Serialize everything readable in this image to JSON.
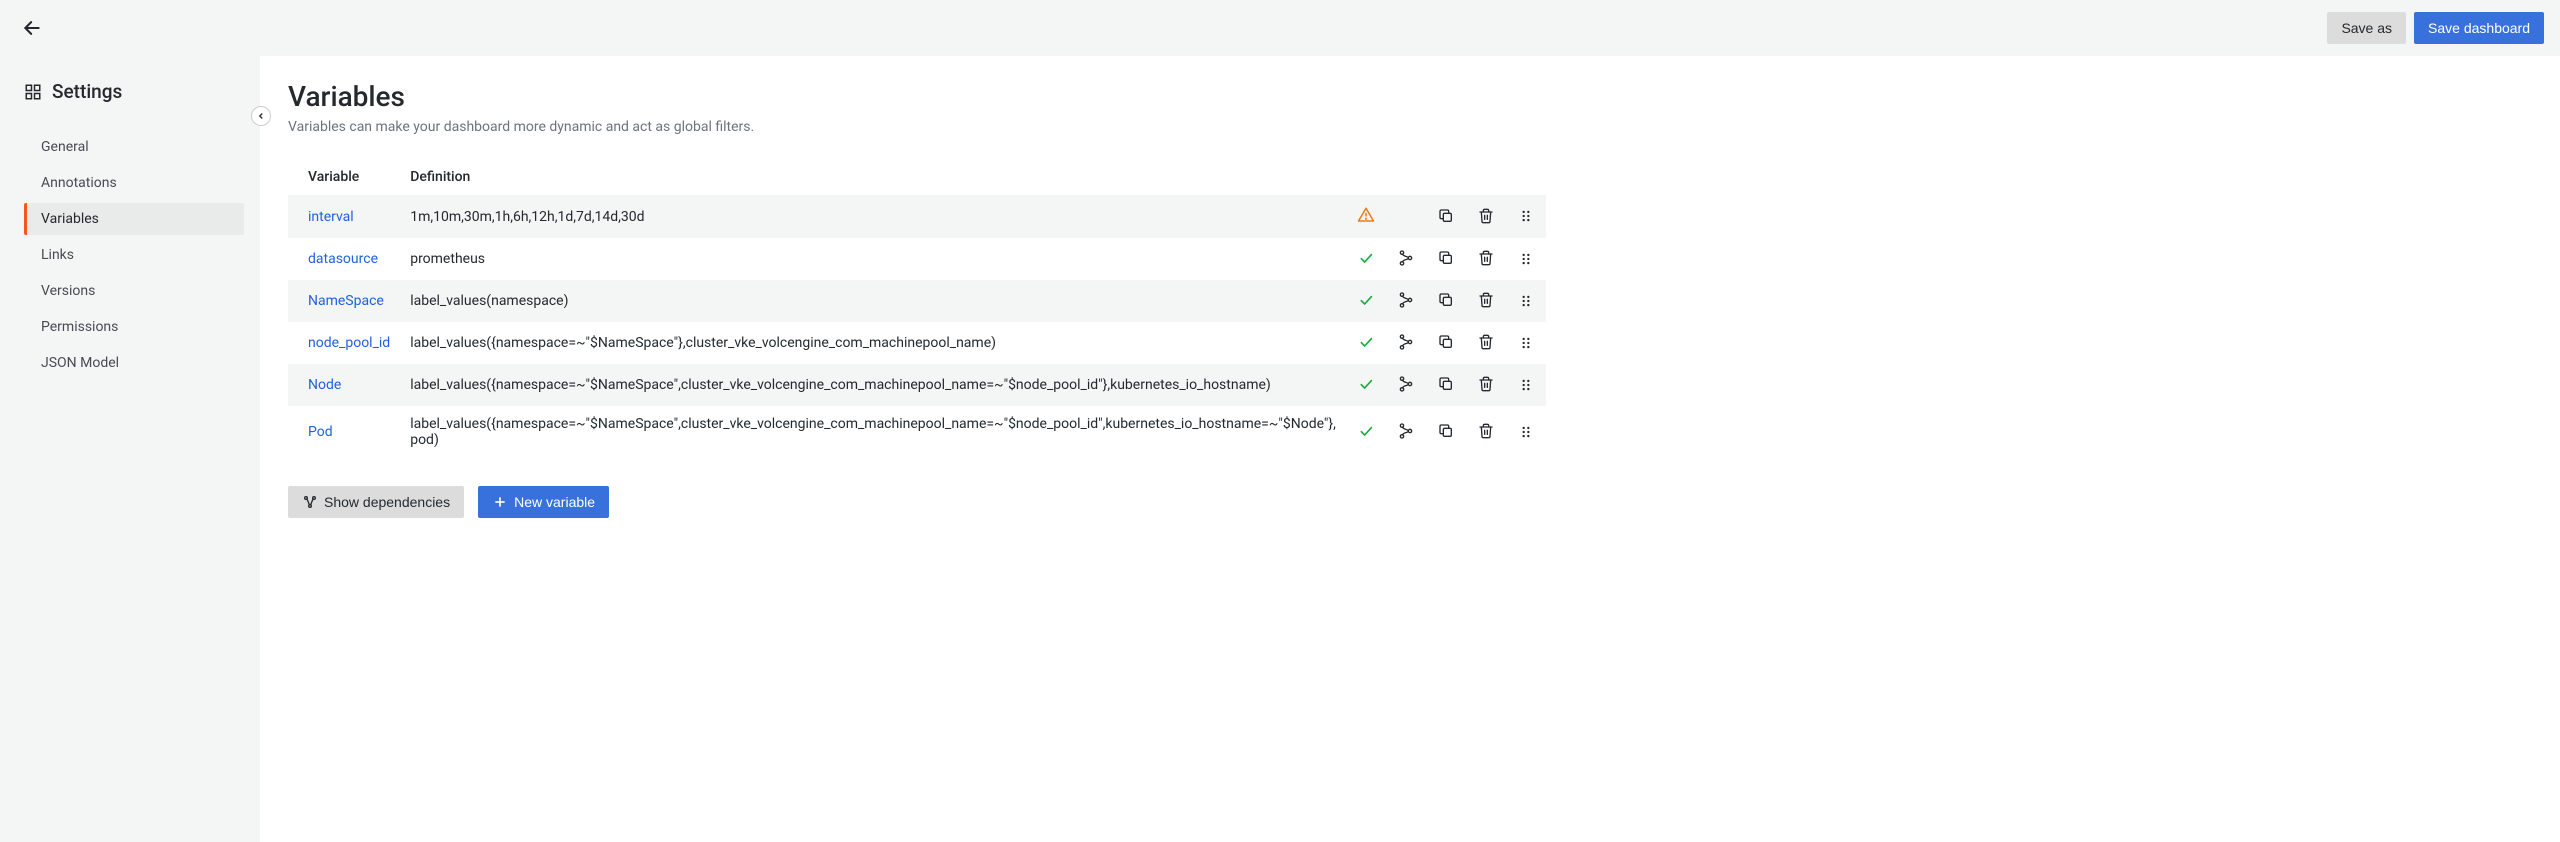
{
  "topbar": {
    "save_as": "Save as",
    "save_dashboard": "Save dashboard"
  },
  "sidebar": {
    "title": "Settings",
    "items": [
      {
        "label": "General",
        "active": false
      },
      {
        "label": "Annotations",
        "active": false
      },
      {
        "label": "Variables",
        "active": true
      },
      {
        "label": "Links",
        "active": false
      },
      {
        "label": "Versions",
        "active": false
      },
      {
        "label": "Permissions",
        "active": false
      },
      {
        "label": "JSON Model",
        "active": false
      }
    ]
  },
  "page": {
    "title": "Variables",
    "subtitle": "Variables can make your dashboard more dynamic and act as global filters."
  },
  "table": {
    "headers": {
      "variable": "Variable",
      "definition": "Definition"
    },
    "rows": [
      {
        "name": "interval",
        "definition": "1m,10m,30m,1h,6h,12h,1d,7d,14d,30d",
        "status": "warn",
        "has_net": false
      },
      {
        "name": "datasource",
        "definition": "prometheus",
        "status": "ok",
        "has_net": true
      },
      {
        "name": "NameSpace",
        "definition": "label_values(namespace)",
        "status": "ok",
        "has_net": true
      },
      {
        "name": "node_pool_id",
        "definition": "label_values({namespace=~\"$NameSpace\"},cluster_vke_volcengine_com_machinepool_name)",
        "status": "ok",
        "has_net": true
      },
      {
        "name": "Node",
        "definition": "label_values({namespace=~\"$NameSpace\",cluster_vke_volcengine_com_machinepool_name=~\"$node_pool_id\"},kubernetes_io_hostname)",
        "status": "ok",
        "has_net": true
      },
      {
        "name": "Pod",
        "definition": "label_values({namespace=~\"$NameSpace\",cluster_vke_volcengine_com_machinepool_name=~\"$node_pool_id\",kubernetes_io_hostname=~\"$Node\"}, pod)",
        "status": "ok",
        "has_net": true
      }
    ]
  },
  "footer": {
    "show_deps": "Show dependencies",
    "new_var": "New variable"
  }
}
